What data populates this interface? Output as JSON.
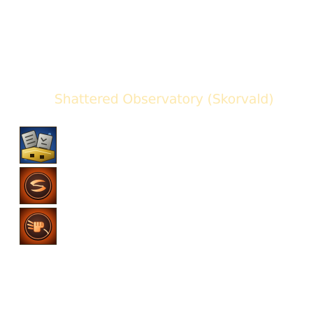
{
  "header": {
    "title": "Shattered Observatory (Skorvald)"
  },
  "icons": [
    {
      "name": "stone-tablets-icon",
      "accent": "#c9a227",
      "background": "#1d4f9c"
    },
    {
      "name": "dash-swirl-icon",
      "accent": "#ff9a3a",
      "background": "#7a2a08"
    },
    {
      "name": "punch-fist-icon",
      "accent": "#ff9a3a",
      "background": "#7a2a08"
    }
  ],
  "colors": {
    "title": "#fde9b0",
    "background": "#ffffff"
  }
}
